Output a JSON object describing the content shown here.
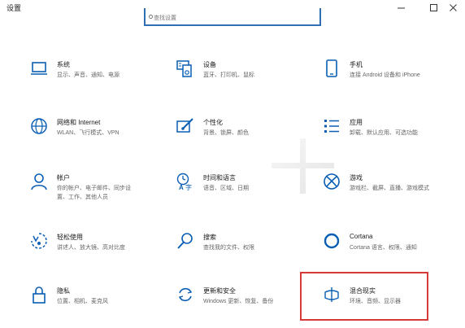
{
  "window": {
    "title": "设置",
    "min_glyph": "—",
    "max_glyph": "□",
    "close_glyph": "✕"
  },
  "search": {
    "placeholder": "查找设置"
  },
  "tiles": [
    {
      "name": "系统",
      "desc": [
        "显示、声音、通知、电源"
      ]
    },
    {
      "name": "设备",
      "desc": [
        "蓝牙、打印机、鼠标"
      ]
    },
    {
      "name": "手机",
      "desc": [
        "连接 Android 设备和 iPhone"
      ]
    },
    {
      "name": "网络和 Internet",
      "desc": [
        "WLAN、飞行模式、VPN"
      ]
    },
    {
      "name": "个性化",
      "desc": [
        "背景、锁屏、颜色"
      ]
    },
    {
      "name": "应用",
      "desc": [
        "卸载、默认应用、可选功能"
      ]
    },
    {
      "name": "帐户",
      "desc": [
        "你的帐户、电子邮件、同步设",
        "置、工作、其他人员"
      ]
    },
    {
      "name": "时间和语言",
      "desc": [
        "语音、区域、日期"
      ]
    },
    {
      "name": "游戏",
      "desc": [
        "游戏栏、截屏、直播、游戏模式"
      ]
    },
    {
      "name": "轻松使用",
      "desc": [
        "讲述人、放大镜、高对比度"
      ]
    },
    {
      "name": "搜索",
      "desc": [
        "查找我的文件、权限"
      ]
    },
    {
      "name": "Cortana",
      "desc": [
        "Cortana 语言、权限、通知"
      ]
    },
    {
      "name": "隐私",
      "desc": [
        "位置、相机、麦克风"
      ]
    },
    {
      "name": "更新和安全",
      "desc": [
        "Windows 更新、恢复、备份"
      ]
    },
    {
      "name": "混合现实",
      "desc": [
        "环境、音频、显示器"
      ]
    }
  ],
  "colors": {
    "accent": "#0a5fb4",
    "highlight_border": "#d63a34"
  },
  "icons": [
    "laptop-icon",
    "keyboard-speaker-icon",
    "phone-icon",
    "globe-icon",
    "paint-brush-icon",
    "app-list-icon",
    "person-icon",
    "time-language-icon",
    "xbox-icon",
    "ease-of-access-icon",
    "search-icon",
    "cortana-icon",
    "lock-icon",
    "sync-icon",
    "mixed-reality-icon"
  ]
}
